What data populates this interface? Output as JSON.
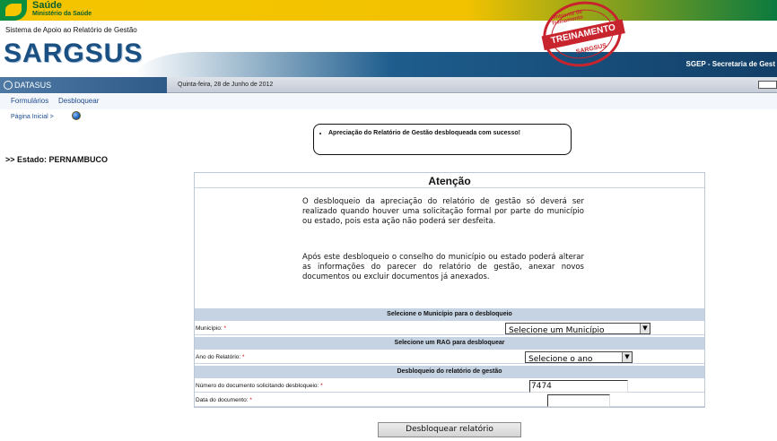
{
  "brand": {
    "saude": "Saúde",
    "ministerio": "Ministério da Saúde",
    "subtitle": "Sistema de Apoio ao Relatório de Gestão",
    "app_name": "SARGSUS",
    "secretaria": "SGEP - Secretaria de Gest",
    "stamp_top": "Ambiente de Treinamento",
    "stamp_band": "TREINAMENTO",
    "stamp_bottom": "SARGSUS"
  },
  "datasus": {
    "label": "DATASUS",
    "date": "Quinta-feira, 28 de Junho de 2012"
  },
  "nav": {
    "formularios": "Formulários",
    "desbloquear": "Desbloquear"
  },
  "breadcrumb": "Página Inicial >",
  "message": "Apreciação do Relatório de Gestão desbloqueada com sucesso!",
  "estado": ">> Estado: PERNAMBUCO",
  "panel": {
    "title": "Atenção",
    "paragraph1": "O desbloqueio da apreciação do relatório de gestão só deverá ser realizado quando houver uma solicitação formal por parte do município ou estado, pois esta ação não poderá ser desfeita.",
    "paragraph2": "Após este desbloqueio o conselho do município ou estado poderá alterar as informações do parecer do relatório de gestão, anexar novos documentos ou excluir documentos já anexados.",
    "section_municipio": "Selecione o Município para o desbloqueio",
    "label_municipio": "Município:",
    "select_municipio": "Selecione um Município",
    "section_rag": "Selecione um RAG para desbloquear",
    "label_ano": "Ano do Relatório:",
    "select_ano": "Selecione o ano",
    "section_desbloqueio": "Desbloqueio do relatório de gestão",
    "label_numero": "Número do documento solicitando desbloqueio:",
    "numero_value": "7474",
    "label_data": "Data do documento:",
    "data_value": "",
    "required_mark": "*"
  },
  "button": "Desbloquear relatório",
  "colors": {
    "brand_blue": "#1a4f82",
    "banner_yellow": "#f4c500",
    "stamp_red": "#c8242e",
    "section_bg": "#c6d3e3"
  }
}
